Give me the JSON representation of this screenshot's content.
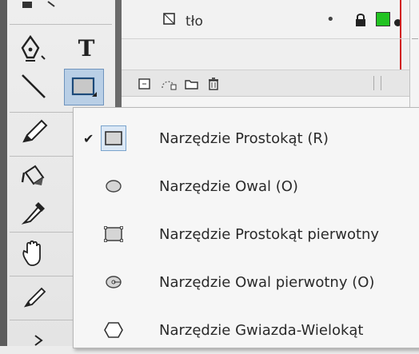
{
  "toolbar": {
    "text_tool_glyph": "T",
    "tools": [
      {
        "name": "pen-tool"
      },
      {
        "name": "text-tool"
      },
      {
        "name": "line-tool"
      },
      {
        "name": "rectangle-tool"
      },
      {
        "name": "pencil-tool"
      },
      {
        "name": "paint-bucket-tool"
      },
      {
        "name": "eyedropper-tool"
      },
      {
        "name": "hand-tool"
      },
      {
        "name": "brush-tool"
      }
    ]
  },
  "timeline": {
    "layer_name": "tło",
    "layer_dot": "•"
  },
  "menu": {
    "checkmark": "✔",
    "items": [
      {
        "label": "Narzędzie Prostokąt (R)",
        "icon": "rectangle-icon",
        "checked": true
      },
      {
        "label": "Narzędzie Owal (O)",
        "icon": "oval-icon",
        "checked": false
      },
      {
        "label": "Narzędzie Prostokąt pierwotny",
        "icon": "primitive-rectangle-icon",
        "checked": false
      },
      {
        "label": "Narzędzie Owal pierwotny (O)",
        "icon": "primitive-oval-icon",
        "checked": false
      },
      {
        "label": "Narzędzie Gwiazda-Wielokąt",
        "icon": "polystar-icon",
        "checked": false
      }
    ]
  },
  "colors": {
    "accent_green": "#22c322",
    "playhead_red": "#d11c1c",
    "selection_blue": "#dbe8f6"
  }
}
